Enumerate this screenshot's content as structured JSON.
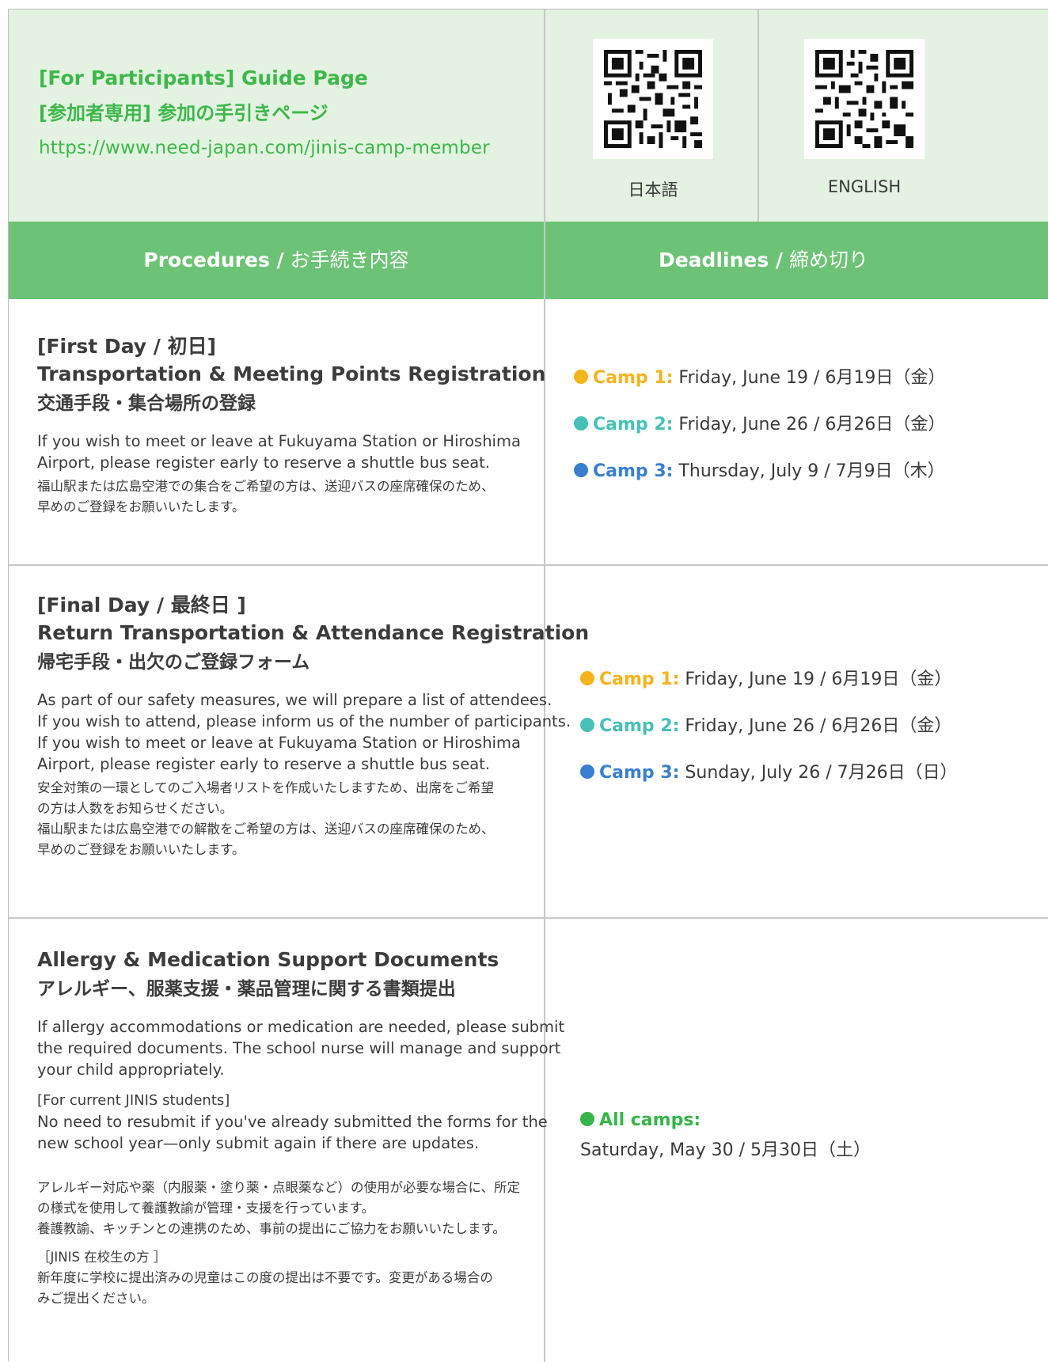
{
  "guide": {
    "title_en": "[For Participants] Guide Page",
    "title_ja": "[参加者専用] 参加の手引きページ",
    "url": "https://www.need-japan.com/jinis-camp-member",
    "qr_japanese_label": "日本語",
    "qr_english_label": "ENGLISH"
  },
  "table_header": {
    "procedures_en": "Procedures /",
    "procedures_ja": " お手続き内容",
    "deadlines_en": "Deadlines /",
    "deadlines_ja": " 締め切り"
  },
  "colors": {
    "green": "#3cb84a",
    "header_green": "#6cc375",
    "light_green": "#e4f2e1",
    "camp1": "#f5b31c",
    "camp2": "#47c0b8",
    "camp3": "#3a7fcf",
    "all_camps": "#36b54a"
  },
  "rows": [
    {
      "tag": "[First Day / 初日]",
      "title_en": "Transportation & Meeting Points Registration",
      "title_ja": "交通手段・集合場所の登録",
      "text_en_1": "If you wish to meet or leave at Fukuyama Station or Hiroshima",
      "text_en_2": "Airport, please register early to reserve a shuttle bus seat.",
      "text_ja_1": "福山駅または広島空港での集合をご希望の方は、送迎バスの座席確保のため、",
      "text_ja_2": "早めのご登録をお願いいたします。",
      "deadlines": [
        {
          "label": "Camp 1:",
          "date": " Friday, June 19 / 6月19日（金）"
        },
        {
          "label": "Camp 2:",
          "date": " Friday, June 26 / 6月26日（金）"
        },
        {
          "label": "Camp 3:",
          "date": " Thursday, July 9 / 7月9日（木）"
        }
      ]
    },
    {
      "tag": "[Final Day / 最終日 ]",
      "title_en": "Return Transportation & Attendance Registration",
      "title_ja": "帰宅手段・出欠のご登録フォーム",
      "text_en_1": "As part of our safety measures, we will prepare a list of attendees.",
      "text_en_2": "If you wish to attend, please inform us of the number of participants.",
      "text_en_3": "If you wish to meet or leave at Fukuyama Station or Hiroshima",
      "text_en_4": "Airport, please register early to reserve a shuttle bus seat.",
      "text_ja_1": "安全対策の一環としてのご入場者リストを作成いたしますため、出席をご希望",
      "text_ja_2": "の方は人数をお知らせください。",
      "text_ja_3": "福山駅または広島空港での解散をご希望の方は、送迎バスの座席確保のため、",
      "text_ja_4": "早めのご登録をお願いいたします。",
      "deadlines": [
        {
          "label": "Camp 1:",
          "date": " Friday, June 19 / 6月19日（金）"
        },
        {
          "label": "Camp 2:",
          "date": " Friday, June 26 / 6月26日（金）"
        },
        {
          "label": "Camp 3:",
          "date": " Sunday, July 26 / 7月26日（日）"
        }
      ]
    },
    {
      "title_en": "Allergy & Medication Support Documents",
      "title_ja": "アレルギー、服薬支援・薬品管理に関する書類提出",
      "text_en_1": "If allergy accommodations or medication are needed, please submit",
      "text_en_2": "the required documents. The school nurse will manage and support",
      "text_en_3": "your child appropriately.",
      "text_en_4": "[For current JINIS students]",
      "text_en_5": "No need to resubmit if you've already submitted the forms for the",
      "text_en_6": "new school year—only submit again if there are updates.",
      "text_ja_1": "アレルギー対応や薬（内服薬・塗り薬・点眼薬など）の使用が必要な場合に、所定",
      "text_ja_2": "の様式を使用して養護教諭が管理・支援を行っています。",
      "text_ja_3": "養護教諭、キッチンとの連携のため、事前の提出にご協力をお願いいたします。",
      "text_ja_4": "［JINIS 在校生の方 ］",
      "text_ja_5": "新年度に学校に提出済みの児童はこの度の提出は不要です。変更がある場合の",
      "text_ja_6": "みご提出ください。",
      "deadline_label": "All camps:",
      "deadline_date": "Saturday, May 30 / 5月30日（土）"
    }
  ]
}
